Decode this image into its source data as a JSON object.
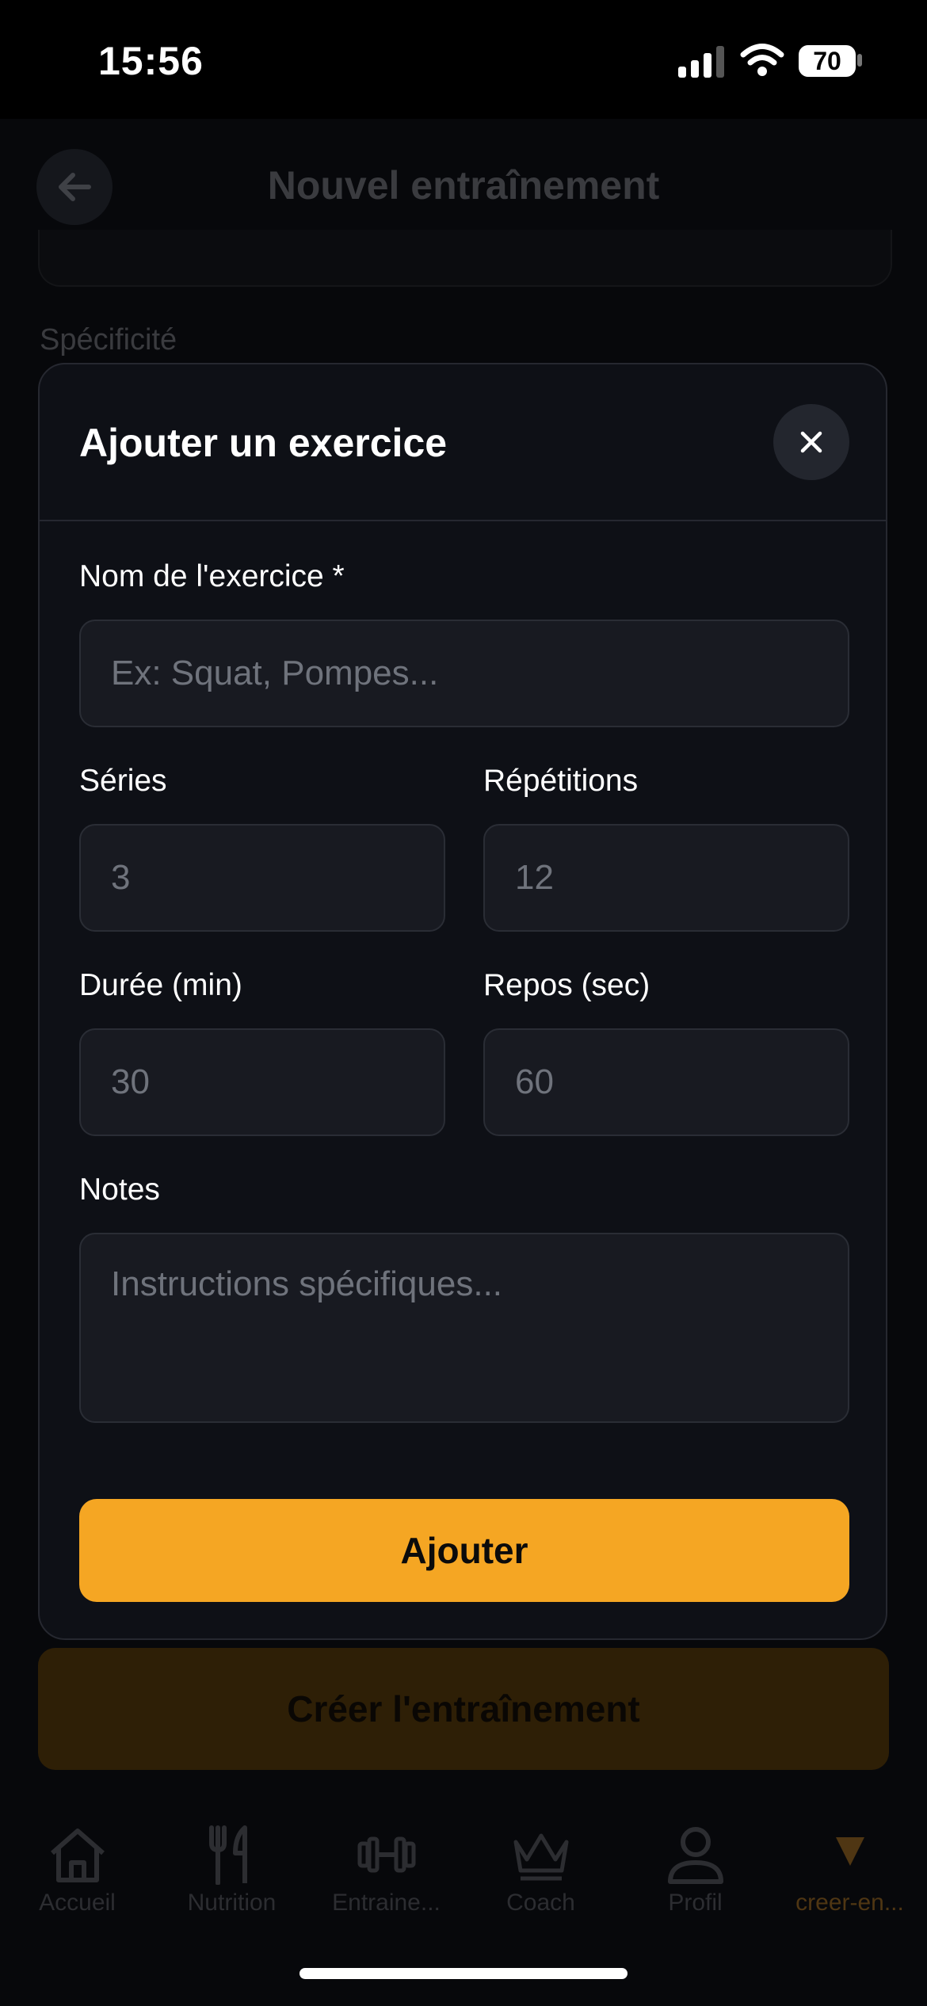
{
  "status_bar": {
    "time": "15:56",
    "battery": "70"
  },
  "header": {
    "title": "Nouvel entraînement"
  },
  "background": {
    "section_label": "Spécificité",
    "create_button": "Créer l'entraînement"
  },
  "modal": {
    "title": "Ajouter un exercice",
    "name_label": "Nom de l'exercice *",
    "name_placeholder": "Ex: Squat, Pompes...",
    "series_label": "Séries",
    "series_placeholder": "3",
    "reps_label": "Répétitions",
    "reps_placeholder": "12",
    "duration_label": "Durée (min)",
    "duration_placeholder": "30",
    "rest_label": "Repos (sec)",
    "rest_placeholder": "60",
    "notes_label": "Notes",
    "notes_placeholder": "Instructions spécifiques...",
    "submit_label": "Ajouter"
  },
  "tabbar": {
    "items": [
      {
        "label": "Accueil",
        "icon": "home-icon"
      },
      {
        "label": "Nutrition",
        "icon": "utensils-icon"
      },
      {
        "label": "Entraine...",
        "icon": "dumbbell-icon"
      },
      {
        "label": "Coach",
        "icon": "crown-icon"
      },
      {
        "label": "Profil",
        "icon": "user-icon"
      },
      {
        "label": "creer-en...",
        "icon": "triangle-down-icon"
      }
    ],
    "active_index": 5
  },
  "colors": {
    "accent": "#f5a623",
    "modal_bg": "#0e1016",
    "field_bg": "#181a21"
  }
}
